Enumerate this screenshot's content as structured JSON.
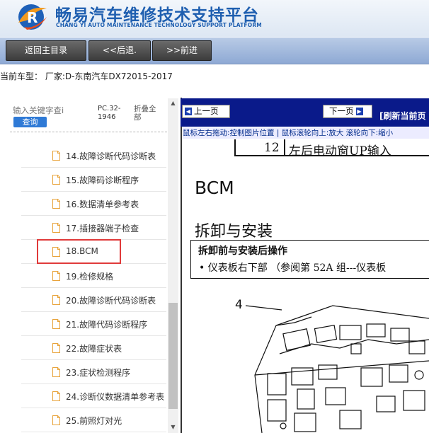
{
  "header": {
    "title": "畅易汽车维修技术支持平台",
    "subtitle": "CHANG YI AUTO MAINTENANCE TECHNOLOGY SUPPORT PLATFORM"
  },
  "nav": {
    "home": "返回主目录",
    "back": "<<后退.",
    "forward": ">>前进"
  },
  "vehicle_line": "当前车型：  厂家:D-东南汽车DX72015-2017",
  "sidebar": {
    "search_placeholder": "输入关键字查i",
    "search_button": "查询",
    "pc_label": "PC.32-1946",
    "collapse_label": "折叠全部",
    "items": [
      {
        "label": "14.故障诊断代码诊断表"
      },
      {
        "label": "15.故障码诊断程序"
      },
      {
        "label": "16.数据清单参考表"
      },
      {
        "label": "17.插接器端子检查"
      },
      {
        "label": "18.BCM"
      },
      {
        "label": "19.检修规格"
      },
      {
        "label": "20.故障诊断代码诊断表"
      },
      {
        "label": "21.故障代码诊断程序"
      },
      {
        "label": "22.故障症状表"
      },
      {
        "label": "23.症状检测程序"
      },
      {
        "label": "24.诊断仪数据清单参考表"
      },
      {
        "label": "25.前照灯对光"
      }
    ],
    "selected_index": 4
  },
  "viewer": {
    "prev_button": "上一页",
    "next_button": "下一页",
    "refresh": "[刷新当前页",
    "hint": "鼠标左右拖动:控制图片位置 | 鼠标滚轮向上:放大  滚轮向下:缩小",
    "doc": {
      "row_num": "12",
      "row_text": "左后电动窗UP输入",
      "heading": "BCM",
      "section": "拆卸与安装",
      "note_title": "拆卸前与安装后操作",
      "note_line": "•  仪表板右下部 （参阅第 52A 组---仪表板",
      "callout": "4"
    }
  },
  "colors": {
    "brand": "#1f5fb0",
    "viewer_toolbar": "#0a1a8a",
    "highlight": "#e03a3a"
  }
}
